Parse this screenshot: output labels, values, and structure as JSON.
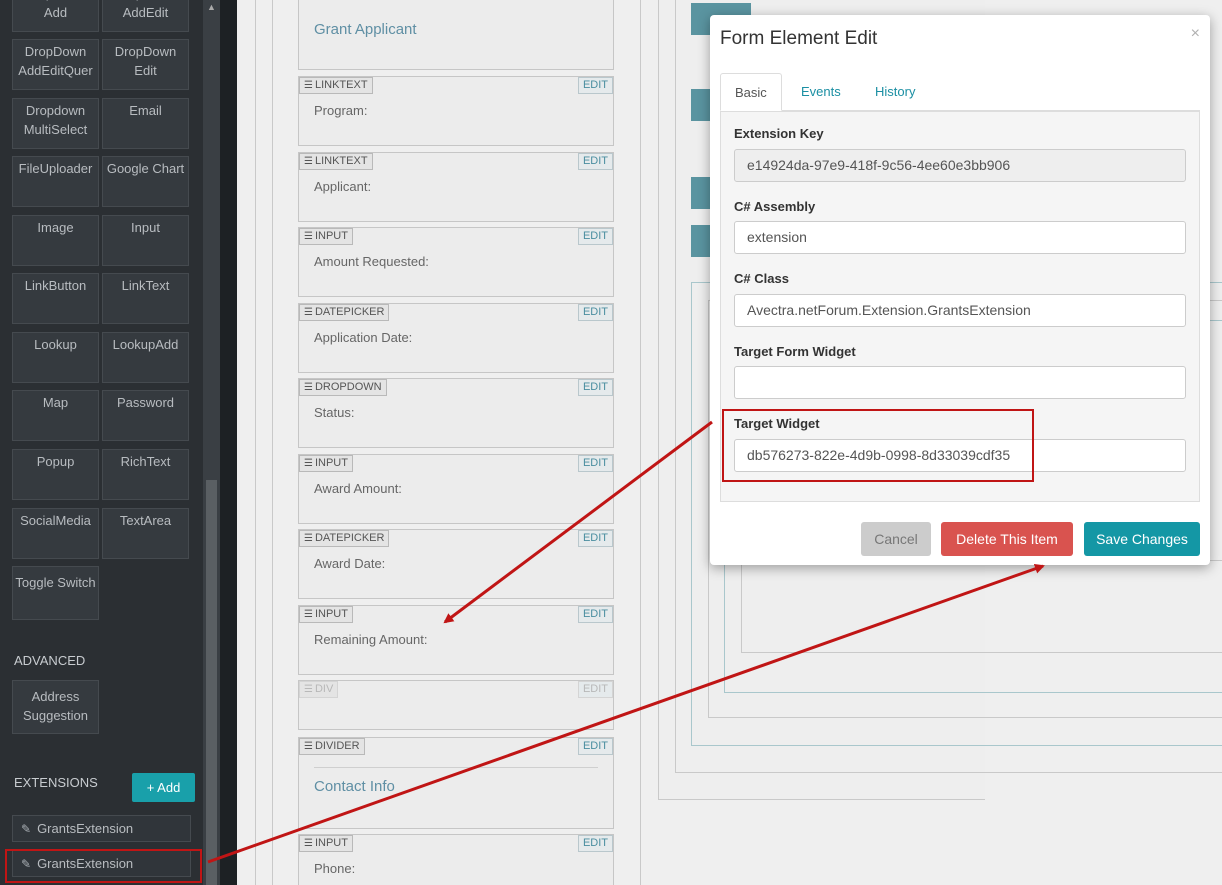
{
  "sidebar": {
    "tiles": [
      "DropDown Add",
      "DropDown AddEdit",
      "DropDown AddEditQuer",
      "DropDown Edit",
      "Dropdown MultiSelect",
      "Email",
      "FileUploader",
      "Google Chart",
      "Image",
      "Input",
      "LinkButton",
      "LinkText",
      "Lookup",
      "LookupAdd",
      "Map",
      "Password",
      "Popup",
      "RichText",
      "SocialMedia",
      "TextArea",
      "Toggle Switch"
    ],
    "advanced_label": "ADVANCED",
    "advanced_tiles": [
      "Address Suggestion"
    ],
    "extensions_label": "EXTENSIONS",
    "add_button": "+ Add",
    "extensions": [
      "GrantsExtension",
      "GrantsExtension"
    ]
  },
  "canvas": {
    "heading_top": "Grant Applicant",
    "fields": [
      {
        "tag": "LINKTEXT",
        "label": "Program:",
        "edit": "EDIT"
      },
      {
        "tag": "LINKTEXT",
        "label": "Applicant:",
        "edit": "EDIT"
      },
      {
        "tag": "INPUT",
        "label": "Amount Requested:",
        "edit": "EDIT"
      },
      {
        "tag": "DATEPICKER",
        "label": "Application Date:",
        "edit": "EDIT"
      },
      {
        "tag": "DROPDOWN",
        "label": "Status:",
        "edit": "EDIT"
      },
      {
        "tag": "INPUT",
        "label": "Award Amount:",
        "edit": "EDIT"
      },
      {
        "tag": "DATEPICKER",
        "label": "Award Date:",
        "edit": "EDIT"
      },
      {
        "tag": "INPUT",
        "label": "Remaining Amount:",
        "edit": "EDIT"
      },
      {
        "tag": "DIV",
        "label": "",
        "edit": "EDIT"
      },
      {
        "tag": "DIVIDER",
        "label": "Contact Info",
        "edit": "EDIT"
      },
      {
        "tag": "INPUT",
        "label": "Phone:",
        "edit": "EDIT"
      }
    ]
  },
  "modal": {
    "title": "Form Element Edit",
    "close": "×",
    "tabs": [
      "Basic",
      "Events",
      "History"
    ],
    "fields": {
      "extension_key_label": "Extension Key",
      "extension_key_value": "e14924da-97e9-418f-9c56-4ee60e3bb906",
      "assembly_label": "C# Assembly",
      "assembly_value": "extension",
      "class_label": "C# Class",
      "class_value": "Avectra.netForum.Extension.GrantsExtension",
      "target_form_widget_label": "Target Form Widget",
      "target_form_widget_value": "",
      "target_widget_label": "Target Widget",
      "target_widget_value": "db576273-822e-4d9b-0998-8d33039cdf35"
    },
    "buttons": {
      "cancel": "Cancel",
      "delete": "Delete This Item",
      "save": "Save Changes"
    }
  },
  "colors": {
    "accent": "#1497a5",
    "danger": "#d9534f",
    "annotation": "#c01515"
  }
}
